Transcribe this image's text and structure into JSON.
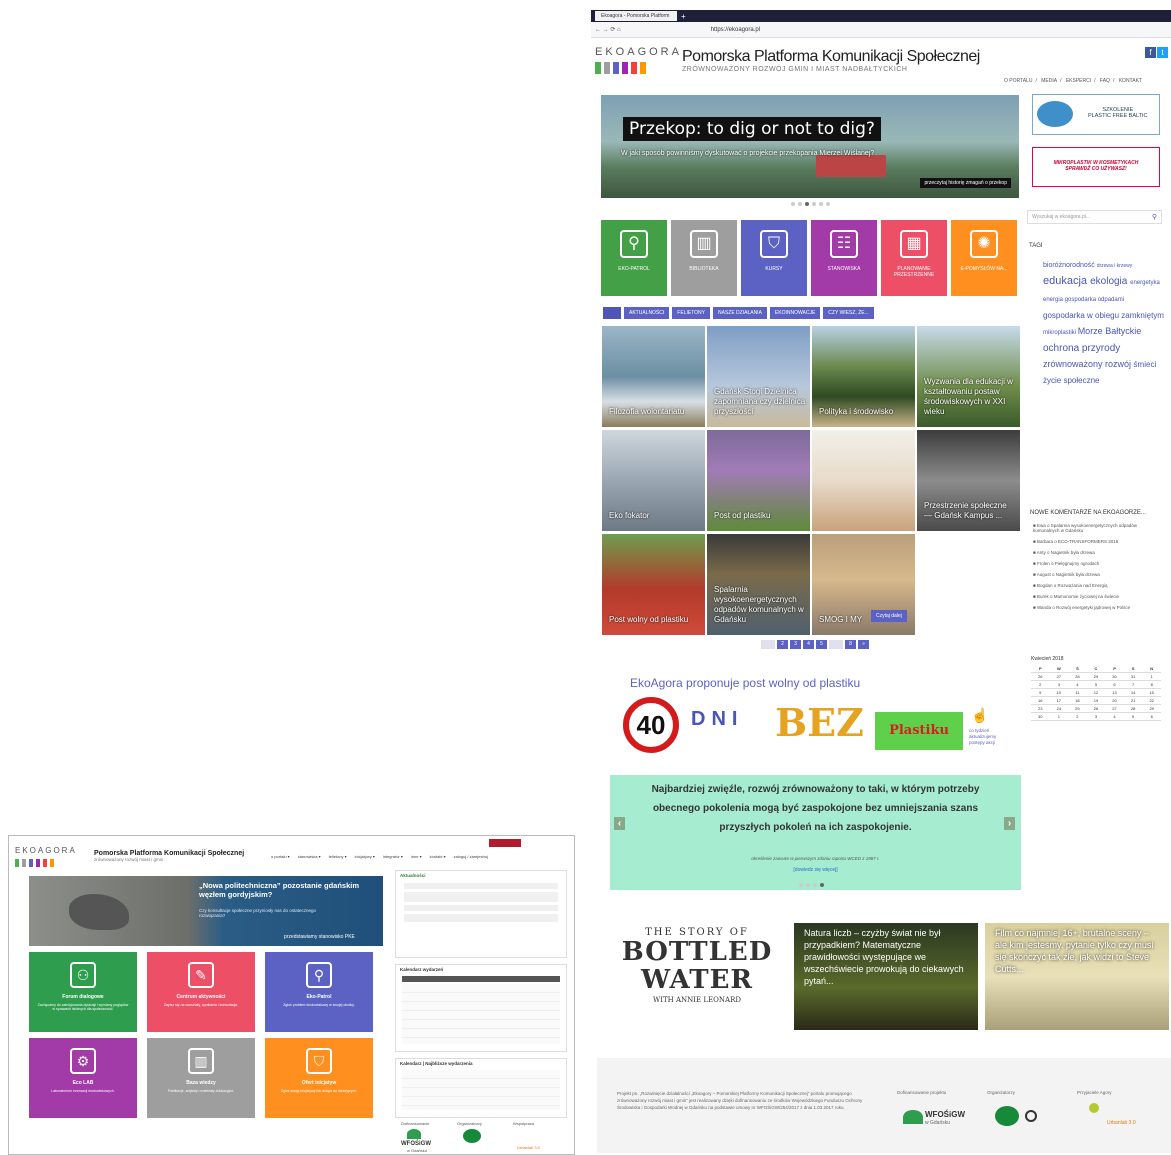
{
  "right": {
    "browser": {
      "tab_title": "Ekoagora - Pomorska Platform",
      "url": "https://ekoagora.pl"
    },
    "header": {
      "logo_word": "EKOAGORA",
      "title": "Pomorska Platforma Komunikacji Społecznej",
      "subtitle": "ZRÓWNOWAŻONY ROZWÓJ GMIN I MIAST NADBAŁTYCKICH",
      "nav": [
        "O PORTALU",
        "MEDIA",
        "EKSPERCI",
        "FAQ",
        "KONTAKT"
      ],
      "bar_colors": [
        "#4caf50",
        "#9e9e9e",
        "#5b62c4",
        "#9c27b0",
        "#f44336",
        "#ff9800"
      ]
    },
    "hero": {
      "title": "Przekop: to dig or not to dig?",
      "desc": "W jaki sposób powinniśmy dyskutować o projekcie przekopania Mierzei Wiślanej?",
      "more": "przeczytaj historię zmagań o przekop"
    },
    "side_banners": {
      "plastic_title": "SZKOLENIE\nPLASTIC FREE BALTIC",
      "micro": "MIKROPLASTIK W KOSMETYKACH\nSPRAWDŹ CO UŻYWASZ!",
      "search_placeholder": "Wyszukaj w ekoagora.pl..."
    },
    "tiles": [
      {
        "label": "EKO-PATROL",
        "color": "#43a047",
        "icon": "⚲"
      },
      {
        "label": "BIBLIOTEKA",
        "color": "#9e9e9e",
        "icon": "▥"
      },
      {
        "label": "KURSY",
        "color": "#5b62c4",
        "icon": "⛉"
      },
      {
        "label": "STANOWISKA",
        "color": "#a23aa8",
        "icon": "☷"
      },
      {
        "label": "PLANOWANIE PRZESTRZENNE",
        "color": "#ec4f66",
        "icon": "▦"
      },
      {
        "label": "E-POMYSŁÓW NA...",
        "color": "#ff8f1f",
        "icon": "✺"
      }
    ],
    "cat_tabs": [
      "",
      "AKTUALNOŚCI",
      "FELIETONY",
      "NASZE DZIAŁANIA",
      "EKOINNOWACJE",
      "CZY WIESZ, ŻE..."
    ],
    "grid": [
      {
        "cap": "Filozofia wolontariatu",
        "bg": "linear-gradient(180deg,#9bb6c8 0%,#6c8fa3 50%,#d7dfe5 75%,#8a7a5a 100%)"
      },
      {
        "cap": "Gdańsk Stogi Dzielnica zapomniana czy dzielnica przyszłości",
        "bg": "linear-gradient(180deg,#7f9ec4 0%,#b7c8dc 60%,#c9b99a 100%)"
      },
      {
        "cap": "Polityka i środowisko",
        "bg": "linear-gradient(180deg,#b9d1e6 0%,#6a8a4e 40%,#2f4a22 70%,#c9b48a 100%)"
      },
      {
        "cap": "Wyzwania dla edukacji w kształtowaniu postaw środowiskowych w XXI wieku",
        "bg": "linear-gradient(180deg,#c7dbea 0%,#6f8d4a 60%,#3a5a2a 100%)"
      },
      {
        "cap": "Eko fokator",
        "bg": "linear-gradient(180deg,#cfd7de 0%,#9aa7b2 50%,#6d7985 100%)"
      },
      {
        "cap": "Post od plastiku",
        "bg": "linear-gradient(180deg,#7d6a9a 0%,#a27bb6 40%,#5f8a3a 100%)"
      },
      {
        "cap": "",
        "bg": "linear-gradient(180deg,#f2efe9 0%,#e8dccb 50%,#c9a27a 100%)"
      },
      {
        "cap": "Przestrzenie społeczne — Gdańsk Kampus ...",
        "bg": "linear-gradient(180deg,#3c3c3c 0%,#8c8c8c 50%,#4a4a4a 100%)"
      },
      {
        "cap": "Post wolny od plastiku",
        "bg": "linear-gradient(180deg,#6e9d4e 0%,#b33a2a 55%,#d04a3a 100%)"
      },
      {
        "cap": "Spalarnia wysokoenergetycznych odpadów komunalnych w Gdańsku",
        "bg": "linear-gradient(180deg,#3a3a3a 0%,#7a6a4a 40%,#50606e 100%)"
      },
      {
        "cap": "SMOG I MY",
        "bg": "linear-gradient(180deg,#b9a07a 0%,#d7b98c 45%,#8a7a6a 100%)"
      }
    ],
    "read_more": "Czytaj dalej",
    "pager": [
      "",
      "2",
      "3",
      "4",
      "5",
      "",
      "8",
      "»"
    ],
    "promo": {
      "title": "EkoAgora proponuje post wolny od plastiku",
      "num": "40",
      "dni": "DNI",
      "bez": "BEZ",
      "plastiku": "Plastiku",
      "hint": "co tydzień aktualizujemy postępy akcji"
    },
    "quote": {
      "text": "Najbardziej zwięźle, rozwój zrównoważony to taki, w którym potrzeby obecnego pokolenia mogą być zaspokojone bez umniejszania szans przyszłych pokoleń na ich zaspokojenie.",
      "src": "określenie zawarte w pierwszym zdaniu raportu WCED z 1987 r.",
      "link": "[dowiedz się więcej]"
    },
    "videos": [
      {
        "title": "",
        "bottled1": "THE STORY OF",
        "bottled2": "BOTTLED",
        "bottled3": "WATER",
        "bottled4": "WITH ANNIE LEONARD"
      },
      {
        "title": "Natura liczb – czyżby świat nie był przypadkiem? Matematyczne prawidłowości występujące we wszechświecie prowokują do ciekawych pytań..."
      },
      {
        "title": "Film co najmniej 16+, brutalne sceny – ale kim jesteśmy. pytanie tylko czy musi się skończyć tak źle, jak widzi to Steve Cutts..."
      }
    ],
    "tags_title": "TAGI",
    "tags": [
      {
        "t": "bioróżnorodność",
        "s": 7
      },
      {
        "t": "drzewa i krzewy",
        "s": 5
      },
      {
        "t": "edukacja",
        "s": 11
      },
      {
        "t": "ekologia",
        "s": 10
      },
      {
        "t": "energetyka",
        "s": 6
      },
      {
        "t": "energia",
        "s": 6
      },
      {
        "t": "gospodarka odpadami",
        "s": 6
      },
      {
        "t": "gospodarka w obiegu zamkniętym",
        "s": 8
      },
      {
        "t": "mikroplastiki",
        "s": 6
      },
      {
        "t": "Morze Bałtyckie",
        "s": 9
      },
      {
        "t": "ochrona przyrody",
        "s": 10
      },
      {
        "t": "zrównoważony rozwój",
        "s": 9
      },
      {
        "t": "śmieci",
        "s": 8
      },
      {
        "t": "życie społeczne",
        "s": 8
      }
    ],
    "comments_title": "NOWE KOMENTARZE NA EKOAGORZE...",
    "comments": [
      "Ewa o Spalarnia wysokoenergetycznych odpadów komunalnych w Gdańsku",
      "Barbara o ECO-TRANSFORMERS 2016",
      "Anty o Nagietnik była drzewa",
      "Frolen o Pielęgnujmy ogrodach",
      "August o Nagietnik była drzewa",
      "Bogdan o Rozważania nad Energią",
      "Burek o Mamonomie życiowej na świecie",
      "Wanda o Rozwój energetyki jądrowej w Polsce"
    ],
    "calendar": {
      "title": "Kwiecień 2018",
      "days": [
        "P",
        "W",
        "Ś",
        "C",
        "P",
        "S",
        "N"
      ],
      "rows": [
        [
          "26",
          "27",
          "28",
          "29",
          "30",
          "31",
          "1"
        ],
        [
          "2",
          "3",
          "4",
          "5",
          "6",
          "7",
          "8"
        ],
        [
          "9",
          "10",
          "11",
          "12",
          "13",
          "14",
          "15"
        ],
        [
          "16",
          "17",
          "18",
          "19",
          "20",
          "21",
          "22"
        ],
        [
          "23",
          "24",
          "25",
          "26",
          "27",
          "28",
          "29"
        ],
        [
          "30",
          "1",
          "2",
          "3",
          "4",
          "5",
          "6"
        ]
      ]
    },
    "footer": {
      "text": "Projekt pn. „Rozwinięcie działalności „Ekoagory – Pomorskiej Platformy Komunikacji Społecznej” portalu promującego zrównoważony rozwój miast i gmin” jest realizowany dzięki dofinansowaniu ze środków Wojewódzkiego Funduszu Ochrony Środowiska i Gospodarki Wodnej w Gdańsku na podstawie umowy nr WFOŚiGW/254/2017 z dnia 1.03.2017 roku.",
      "col1": "Dofinansowanie projektu",
      "col2": "Organizatorzy",
      "col3": "Przyjaciele Agory",
      "wfos": "WFOŚiGW",
      "wfos_sub": "w Gdańsku",
      "urban": "Urbanlab 3.0"
    }
  },
  "left": {
    "header": {
      "logo_word": "EKOAGORA",
      "title": "Pomorska Platforma Komunikacji Społecznej",
      "subtitle": "zrównoważony rozwój miast i gmin",
      "nav": [
        "o portalu ▾",
        "stanowiska ▾",
        "felietony ▾",
        "inicjatywy ▾",
        "integrator ▾",
        "inne ▾",
        "kontakt ▾",
        "zaloguj / zarejestruj"
      ]
    },
    "hero": {
      "title": "„Nowa politechniczna” pozostanie gdańskim węzłem gordyjskim?",
      "desc": "Czy konsultacje społeczne przyniosły nas do ostatecznego rozwiązania?",
      "more": "przedstawiamy stanowisko PKE"
    },
    "tiles": [
      {
        "name": "Forum dialogowe",
        "desc": "Zachęcamy do zainicjowania dyskusji i wymiany poglądów w sprawach istotnych dla społeczności.",
        "color": "#2e9e4e",
        "icon": "⚇"
      },
      {
        "name": "Centrum aktywności",
        "desc": "Zapisz się na warsztaty, spotkania i konsultacje.",
        "color": "#ec4f66",
        "icon": "✎"
      },
      {
        "name": "Eko-Patrol",
        "desc": "Zgłoś problem środowiskowy w swojej okolicy.",
        "color": "#5b62c4",
        "icon": "⚲"
      },
      {
        "name": "Eco LAB",
        "desc": "Laboratorium innowacji środowiskowych.",
        "color": "#a23aa8",
        "icon": "⚙"
      },
      {
        "name": "Baza wiedzy",
        "desc": "Publikacje, artykuły i materiały edukacyjne.",
        "color": "#9e9e9e",
        "icon": "▥"
      },
      {
        "name": "Ofert inicjatyw",
        "desc": "Zgłoś swoją inicjatywę lub dołącz do istniejących.",
        "color": "#ff8f1f",
        "icon": "⛉"
      }
    ],
    "side": {
      "news_title": "Aktualności",
      "calendar_title": "Kalendarz wydarzeń",
      "events_title": "Kalendarz | Najbliższe wydarzenia"
    },
    "footer": {
      "col1": "Dofinansowanie",
      "col2": "Organizatorzy",
      "col3": "Współpraca",
      "wfos": "WFOŚiGW",
      "wfos_sub": "w Gdańsku",
      "urban": "Urbanlab 3.0"
    }
  }
}
